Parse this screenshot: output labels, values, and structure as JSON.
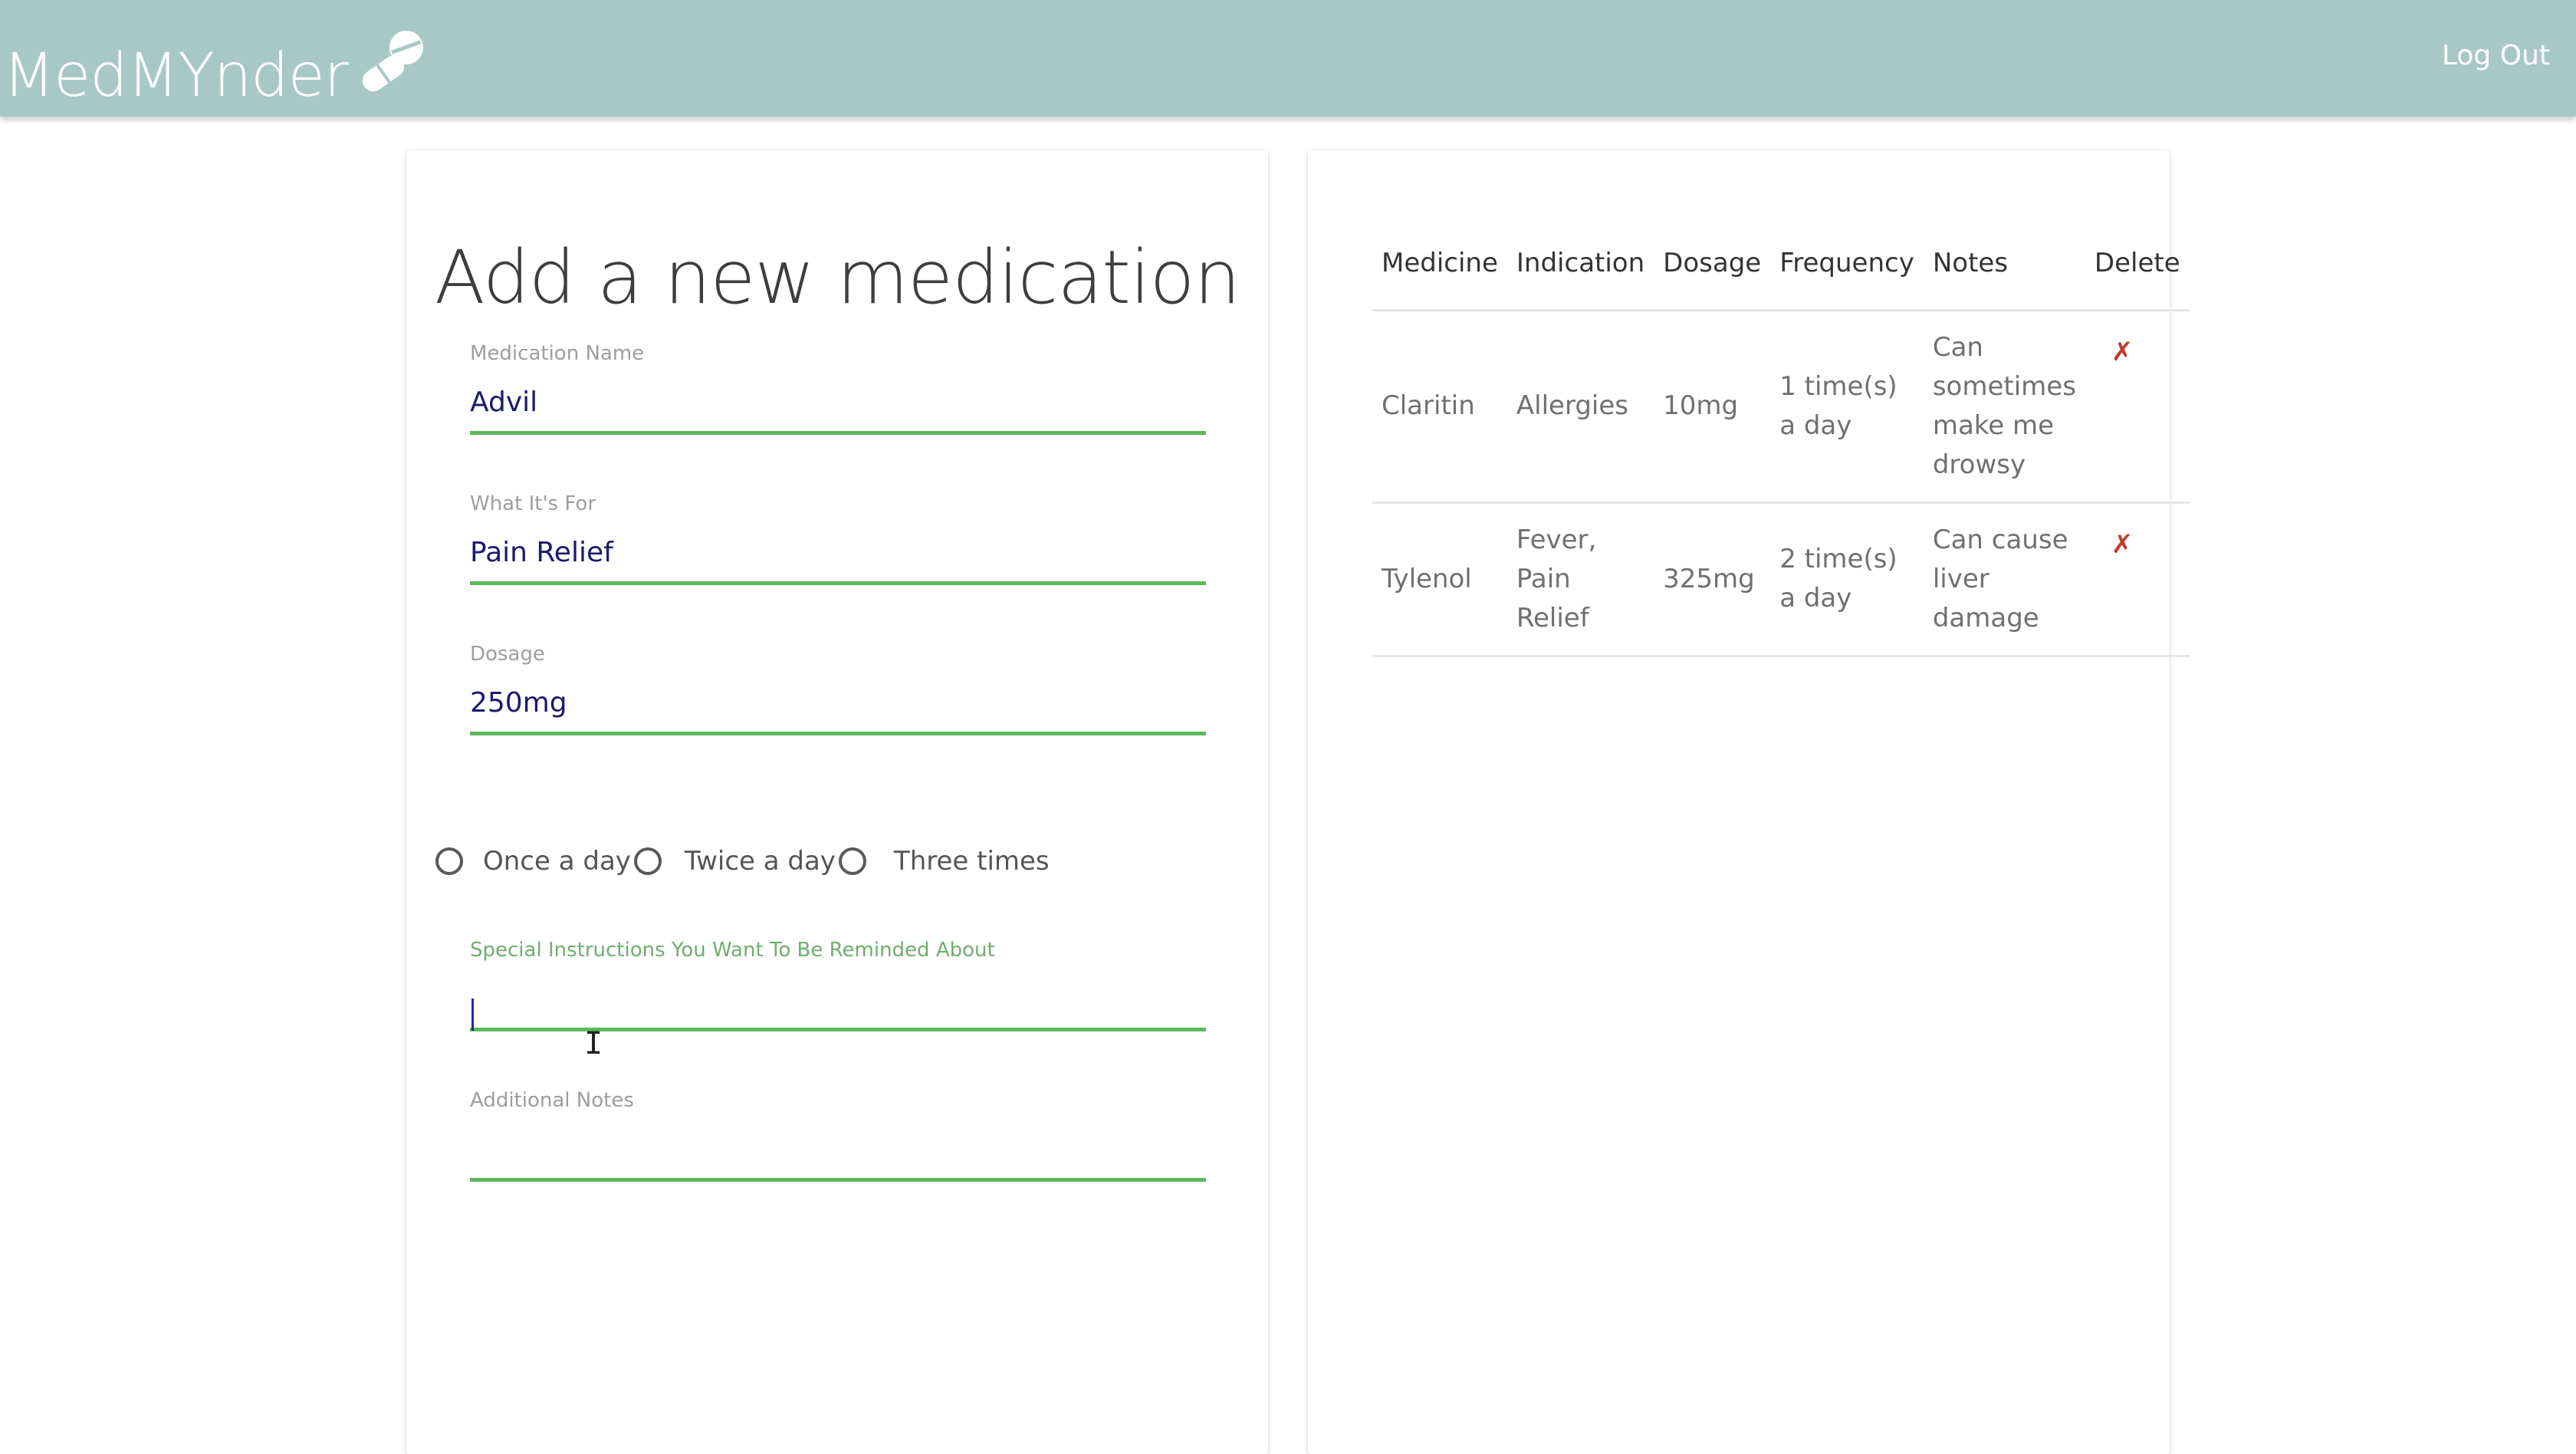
{
  "header": {
    "brand": "MedMYnder",
    "logout_label": "Log Out",
    "bar_color": "#a8c8c8"
  },
  "form": {
    "title": "Add a new medication",
    "fields": {
      "medication_name": {
        "label": "Medication Name",
        "value": "Advil"
      },
      "indication": {
        "label": "What It's For",
        "value": "Pain Relief"
      },
      "dosage": {
        "label": "Dosage",
        "value": "250mg"
      },
      "instructions": {
        "label": "Special Instructions You Want To Be Reminded About",
        "value": ""
      },
      "notes": {
        "label": "Additional Notes",
        "value": ""
      }
    },
    "frequency_options": [
      "Once a day",
      "Twice a day",
      "Three times"
    ],
    "accent_color": "#5cb85c"
  },
  "table": {
    "headers": [
      "Medicine",
      "Indication",
      "Dosage",
      "Frequency",
      "Notes",
      "Delete"
    ],
    "rows": [
      {
        "medicine": "Claritin",
        "indication": "Allergies",
        "dosage": "10mg",
        "frequency": "1 time(s) a day",
        "notes": "Can sometimes make me drowsy",
        "delete": "✗"
      },
      {
        "medicine": "Tylenol",
        "indication": "Fever, Pain Relief",
        "dosage": "325mg",
        "frequency": "2 time(s) a day",
        "notes": "Can cause liver damage",
        "delete": "✗"
      }
    ],
    "delete_color": "#c0392b"
  },
  "icons": {
    "brand_icon": "pill-icon",
    "delete_icon": "cross-mark-icon",
    "mouse_cursor": "text-cursor-icon"
  }
}
